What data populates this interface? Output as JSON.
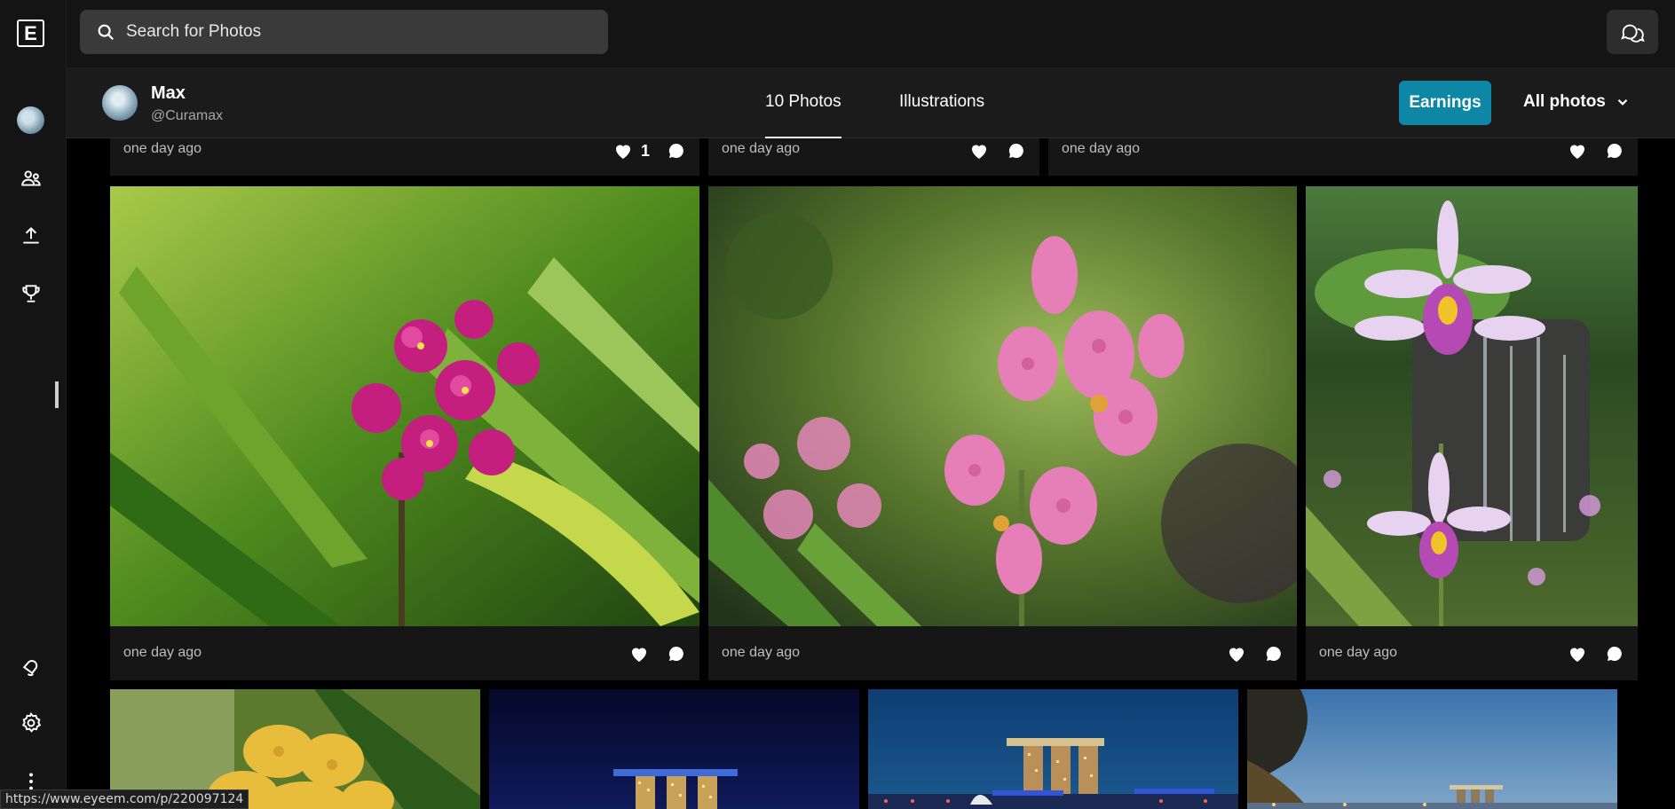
{
  "search": {
    "placeholder": "Search for Photos"
  },
  "profile": {
    "name": "Max",
    "handle": "@Curamax"
  },
  "tabs": [
    {
      "label": "10 Photos",
      "active": true
    },
    {
      "label": "Illustrations",
      "active": false
    }
  ],
  "earnings_label": "Earnings",
  "filter_label": "All photos",
  "row_top": [
    {
      "time": "one day ago",
      "likes": "1"
    },
    {
      "time": "one day ago",
      "likes": ""
    },
    {
      "time": "one day ago",
      "likes": ""
    }
  ],
  "row_main": [
    {
      "time": "one day ago",
      "subject": "magenta orchid"
    },
    {
      "time": "one day ago",
      "subject": "pink spotted orchid"
    },
    {
      "time": "one day ago",
      "subject": "lilac orchid with fountain"
    }
  ],
  "row_bottom": [
    {
      "subject": "yellow orchid"
    },
    {
      "subject": "marina bay night"
    },
    {
      "subject": "marina bay skyline"
    },
    {
      "subject": "marina bay dusk"
    }
  ],
  "status_url": "https://www.eyeem.com/p/220097124",
  "colors": {
    "accent": "#0d87a5",
    "background": "#000000",
    "panel": "#141414"
  }
}
